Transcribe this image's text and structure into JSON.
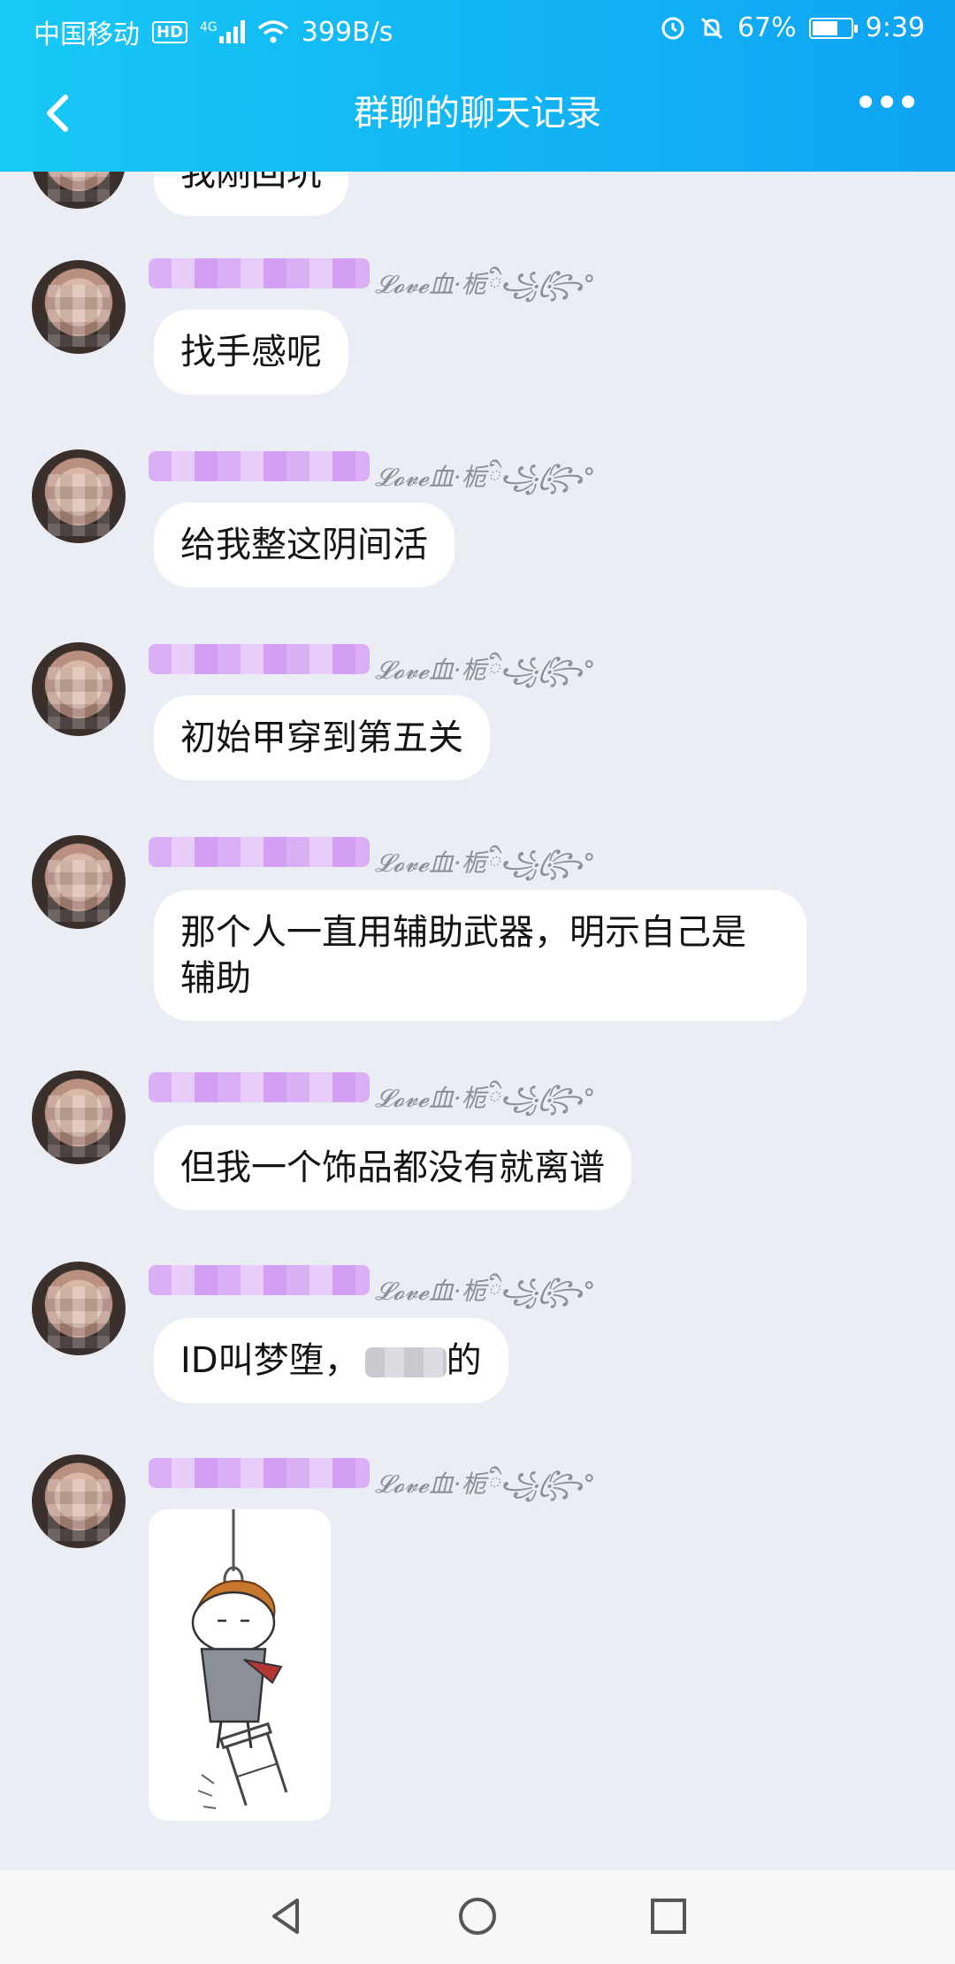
{
  "status_bar": {
    "carrier": "中国移动",
    "network": "HD",
    "generation": "4G",
    "speed": "399B/s",
    "battery": "67%",
    "battery_level": 0.67,
    "time": "9:39"
  },
  "header": {
    "title": "群聊的聊天记录",
    "back_icon": "chevron-left-icon",
    "more_icon": "more-dots-icon"
  },
  "chat": {
    "partial_text": "我刚回坑",
    "nickname_suffix": "𝓛𝓸𝓿𝓮血·栀ི꧁꧂ꦿ°",
    "messages": [
      {
        "text": "找手感呢"
      },
      {
        "text": "给我整这阴间活"
      },
      {
        "text": "初始甲穿到第五关"
      },
      {
        "text": "那个人一直用辅助武器，明示自己是辅助"
      },
      {
        "text": "但我一个饰品都没有就离谱"
      },
      {
        "text_before": "ID叫梦堕，",
        "text_after": "的"
      },
      {
        "type": "sticker",
        "description_icon": "hanging-sticker-image"
      }
    ]
  },
  "system_nav": {
    "back": "triangle-back-icon",
    "home": "circle-home-icon",
    "recents": "square-recents-icon"
  },
  "colors": {
    "header_gradient_start": "#17c8f5",
    "header_gradient_end": "#0ea3f3",
    "chat_background": "#eaedf4",
    "bubble": "#ffffff"
  }
}
